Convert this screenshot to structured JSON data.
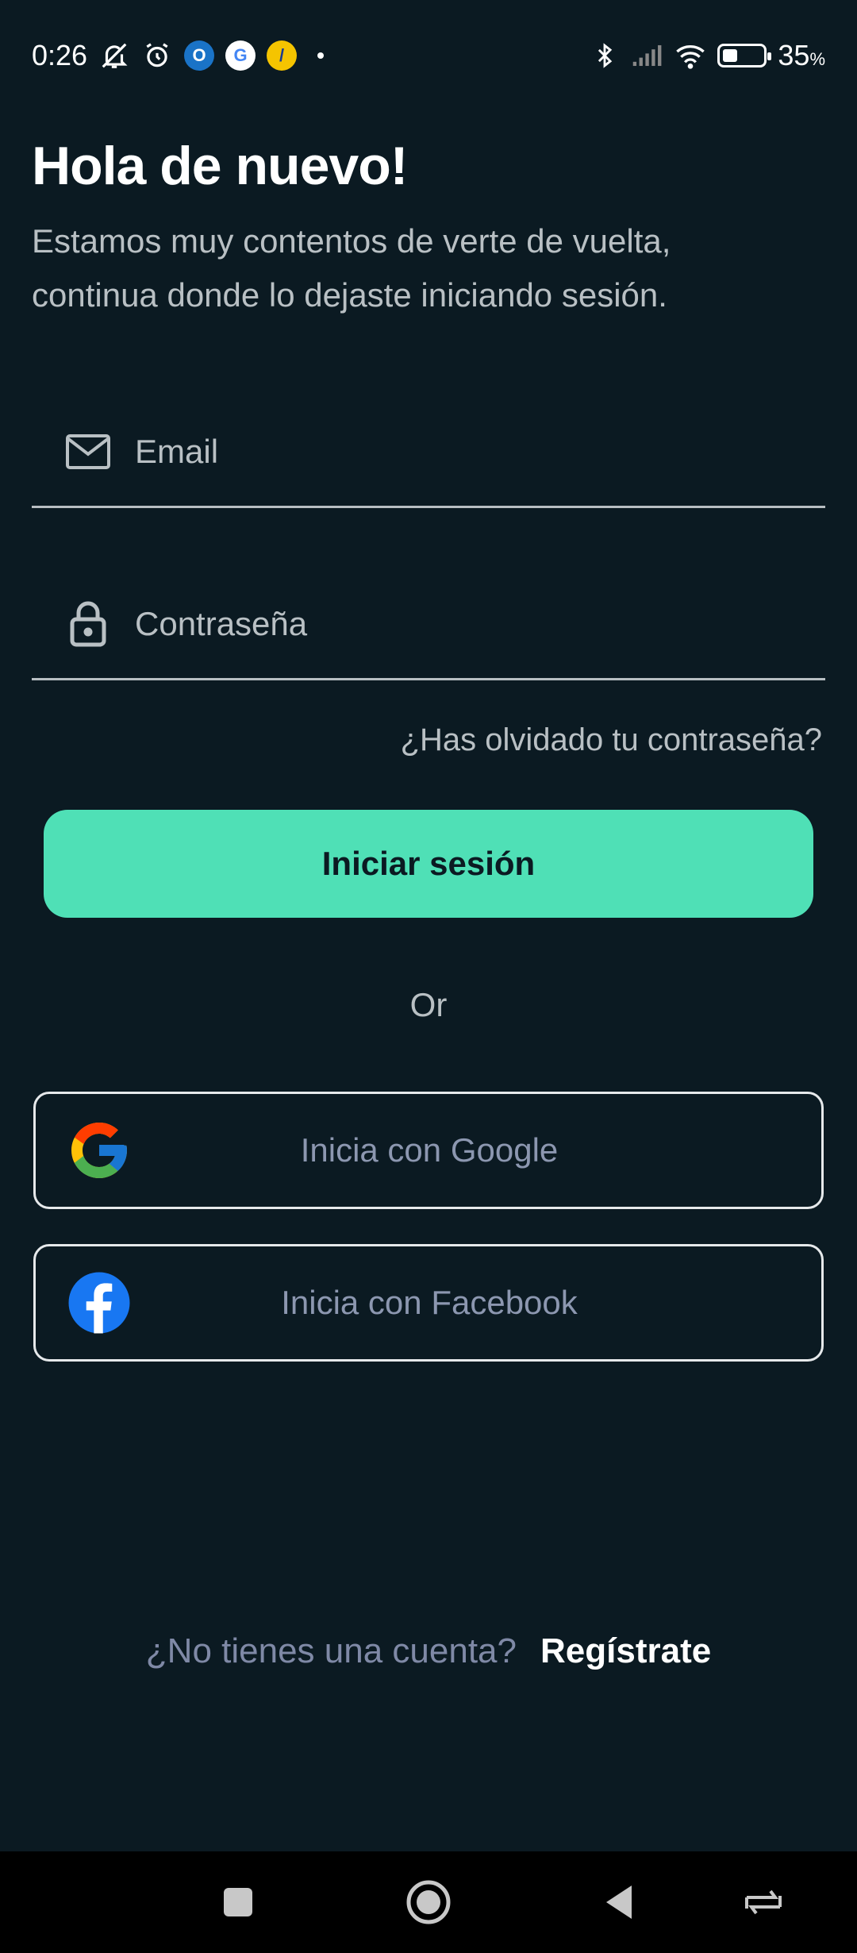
{
  "status_bar": {
    "time": "0:26",
    "battery_percent": "35",
    "battery_unit": "%",
    "icons": [
      "mute-icon",
      "alarm-icon",
      "outlook-icon",
      "google-icon",
      "app-icon",
      "bluetooth-icon",
      "signal-icon",
      "wifi-icon",
      "battery-icon"
    ]
  },
  "header": {
    "title": "Hola de nuevo!",
    "subtitle_line1": "Estamos muy contentos de verte de vuelta,",
    "subtitle_line2": "continua donde lo dejaste iniciando sesión."
  },
  "form": {
    "email_placeholder": "Email",
    "password_placeholder": "Contraseña",
    "forgot_label": "¿Has olvidado tu contraseña?",
    "submit_label": "Iniciar sesión"
  },
  "divider": {
    "label": "Or"
  },
  "social": {
    "google_label": "Inicia con Google",
    "facebook_label": "Inicia con Facebook"
  },
  "footer": {
    "question": "¿No tienes una cuenta?",
    "signup_label": "Regístrate"
  },
  "colors": {
    "background": "#0b1a22",
    "accent": "#4fe0b6",
    "muted_text": "#b9c0c4",
    "social_text": "#8c97b0"
  }
}
